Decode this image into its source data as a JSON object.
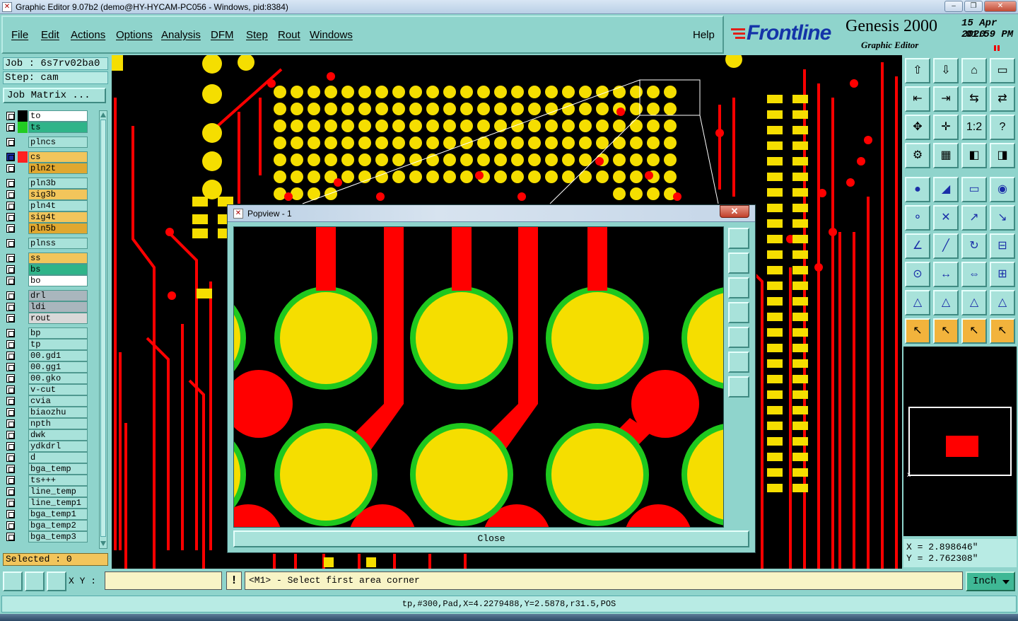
{
  "window": {
    "title": "Graphic Editor 9.07b2 (demo@HY-HYCAM-PC056 - Windows, pid:8384)"
  },
  "menu": [
    "File",
    "Edit",
    "Actions",
    "Options",
    "Analysis",
    "DFM",
    "Step",
    "Rout",
    "Windows"
  ],
  "help": "Help",
  "brand": {
    "logo": "Frontline",
    "product": "Genesis 2000",
    "subtitle": "Graphic Editor",
    "date": "15 Apr 2020",
    "time": "01:59 PM"
  },
  "job": {
    "job_label": "Job : 6s7rv02ba0",
    "step_label": "Step: cam",
    "matrix_button": "Job Matrix ..."
  },
  "layers": [
    {
      "name": "to",
      "color": "#ffffff",
      "swatch": "#000000"
    },
    {
      "name": "ts",
      "color": "#2fb489",
      "swatch": "#22cc22"
    },
    {
      "name": "plncs",
      "color": "#a8e2da",
      "swatch": ""
    },
    {
      "name": "cs",
      "color": "#f2c55b",
      "swatch": "#ff2020",
      "work": true
    },
    {
      "name": "pln2t",
      "color": "#e0a830",
      "swatch": ""
    },
    {
      "name": "pln3b",
      "color": "#a8e2da",
      "swatch": ""
    },
    {
      "name": "sig3b",
      "color": "#f2c55b",
      "swatch": ""
    },
    {
      "name": "pln4t",
      "color": "#a8e2da",
      "swatch": ""
    },
    {
      "name": "sig4t",
      "color": "#f2c55b",
      "swatch": ""
    },
    {
      "name": "pln5b",
      "color": "#e0a830",
      "swatch": ""
    },
    {
      "name": "plnss",
      "color": "#a8e2da",
      "swatch": ""
    },
    {
      "name": "ss",
      "color": "#f2c55b",
      "swatch": ""
    },
    {
      "name": "bs",
      "color": "#2fb489",
      "swatch": ""
    },
    {
      "name": "bo",
      "color": "#ffffff",
      "swatch": ""
    },
    {
      "name": "drl",
      "color": "#a9b6bd",
      "swatch": ""
    },
    {
      "name": "ldi",
      "color": "#a9b6bd",
      "swatch": ""
    },
    {
      "name": "rout",
      "color": "#d8d8d8",
      "swatch": ""
    },
    {
      "name": "bp",
      "color": "#a8e2da",
      "swatch": ""
    },
    {
      "name": "tp",
      "color": "#a8e2da",
      "swatch": ""
    },
    {
      "name": "00.gd1",
      "color": "#a8e2da",
      "swatch": ""
    },
    {
      "name": "00.gg1",
      "color": "#a8e2da",
      "swatch": ""
    },
    {
      "name": "00.gko",
      "color": "#a8e2da",
      "swatch": ""
    },
    {
      "name": "v-cut",
      "color": "#a8e2da",
      "swatch": ""
    },
    {
      "name": "cvia",
      "color": "#a8e2da",
      "swatch": ""
    },
    {
      "name": "biaozhu",
      "color": "#a8e2da",
      "swatch": ""
    },
    {
      "name": "npth",
      "color": "#a8e2da",
      "swatch": ""
    },
    {
      "name": "dwk",
      "color": "#a8e2da",
      "swatch": ""
    },
    {
      "name": "ydkdrl",
      "color": "#a8e2da",
      "swatch": ""
    },
    {
      "name": "d",
      "color": "#a8e2da",
      "swatch": ""
    },
    {
      "name": "bga_temp",
      "color": "#a8e2da",
      "swatch": ""
    },
    {
      "name": "ts+++",
      "color": "#a8e2da",
      "swatch": ""
    },
    {
      "name": "line_temp",
      "color": "#a8e2da",
      "swatch": ""
    },
    {
      "name": "line_temp1",
      "color": "#a8e2da",
      "swatch": ""
    },
    {
      "name": "bga_temp1",
      "color": "#a8e2da",
      "swatch": ""
    },
    {
      "name": "bga_temp2",
      "color": "#a8e2da",
      "swatch": ""
    },
    {
      "name": "bga_temp3",
      "color": "#a8e2da",
      "swatch": ""
    }
  ],
  "selected_label": "Selected : 0",
  "popview": {
    "title": "Popview - 1",
    "close_button": "Close"
  },
  "coords": {
    "x": "X = 2.898646\"",
    "y": "Y = 2.762308\""
  },
  "bottom": {
    "xy_label": "X Y :",
    "xy_value": "",
    "warn": "!",
    "prompt": "<M1> - Select first area corner",
    "units": "Inch"
  },
  "status_line": "tp,#300,Pad,X=4.2279488,Y=2.5878,r31.5,POS",
  "colors": {
    "copper": "#ff0000",
    "pad": "#f5de00",
    "mask": "#1ec81e",
    "panel": "#8fd4cc"
  }
}
